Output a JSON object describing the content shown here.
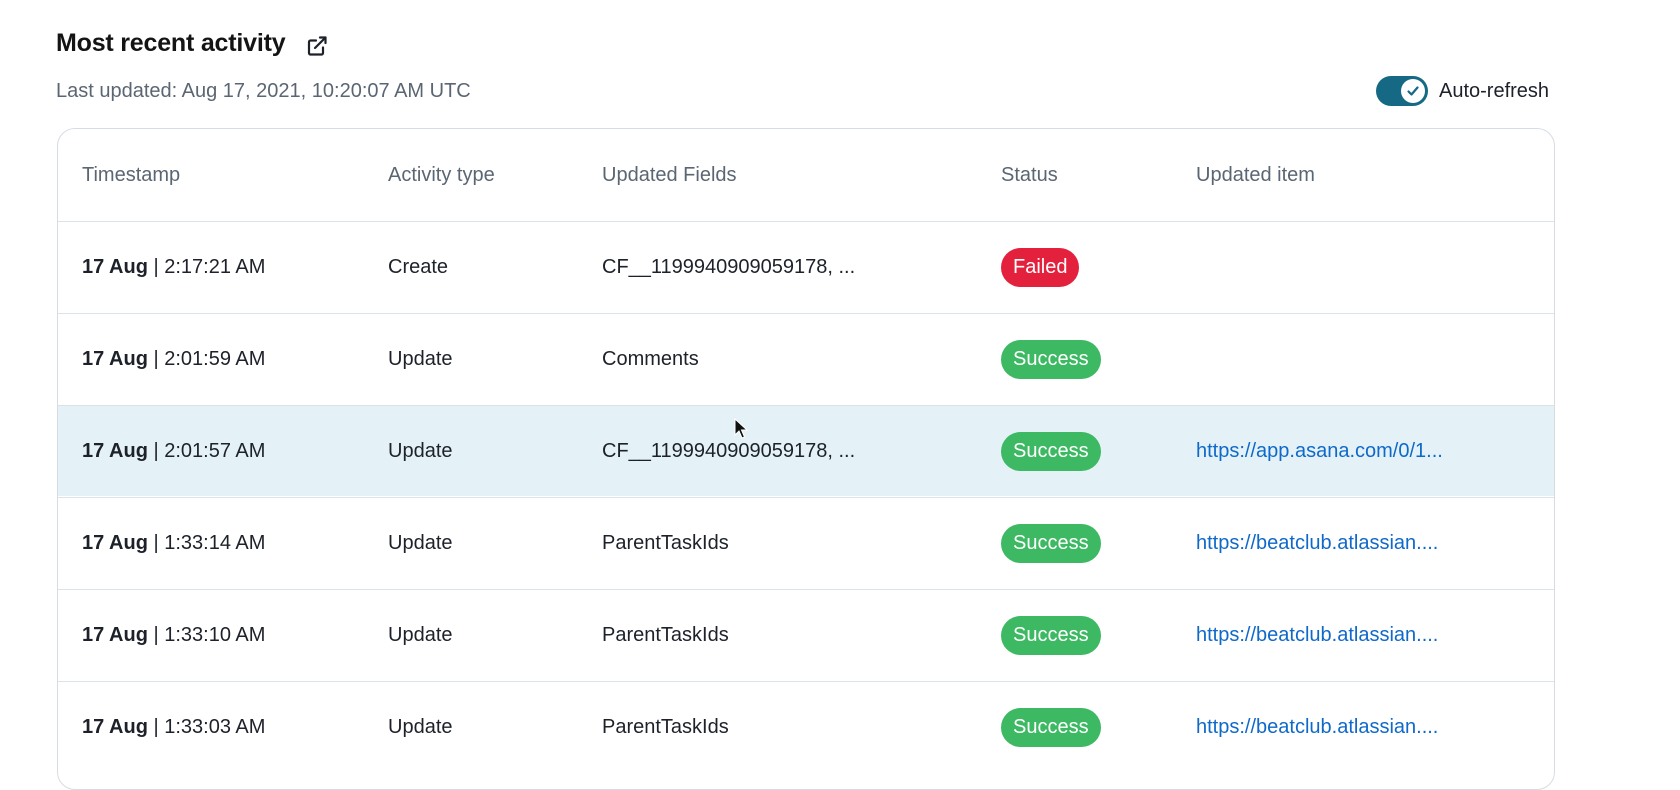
{
  "header": {
    "title": "Most recent activity",
    "last_updated": "Last updated: Aug 17, 2021, 10:20:07 AM UTC",
    "external_link_icon": "external-link-icon"
  },
  "auto_refresh": {
    "label": "Auto-refresh",
    "enabled": true,
    "accent_color": "#156985"
  },
  "table": {
    "columns": [
      "Timestamp",
      "Activity type",
      "Updated Fields",
      "Status",
      "Updated item"
    ],
    "rows": [
      {
        "date": "17 Aug",
        "time": " | 2:17:21 AM",
        "activity": "Create",
        "fields": "CF__1199940909059178, ...",
        "status": "Failed",
        "status_kind": "failed",
        "item": ""
      },
      {
        "date": "17 Aug",
        "time": " | 2:01:59 AM",
        "activity": "Update",
        "fields": "Comments",
        "status": "Success",
        "status_kind": "success",
        "item": ""
      },
      {
        "date": "17 Aug",
        "time": " | 2:01:57 AM",
        "activity": "Update",
        "fields": "CF__1199940909059178, ...",
        "status": "Success",
        "status_kind": "success",
        "item": "https://app.asana.com/0/1...",
        "highlighted": true
      },
      {
        "date": "17 Aug",
        "time": " | 1:33:14 AM",
        "activity": "Update",
        "fields": "ParentTaskIds",
        "status": "Success",
        "status_kind": "success",
        "item": "https://beatclub.atlassian...."
      },
      {
        "date": "17 Aug",
        "time": " | 1:33:10 AM",
        "activity": "Update",
        "fields": "ParentTaskIds",
        "status": "Success",
        "status_kind": "success",
        "item": "https://beatclub.atlassian...."
      },
      {
        "date": "17 Aug",
        "time": " | 1:33:03 AM",
        "activity": "Update",
        "fields": "ParentTaskIds",
        "status": "Success",
        "status_kind": "success",
        "item": "https://beatclub.atlassian...."
      }
    ]
  },
  "colors": {
    "failed": "#e3213d",
    "success": "#3cb962",
    "link": "#0f69c9",
    "row_highlight": "#e4f2f8"
  }
}
